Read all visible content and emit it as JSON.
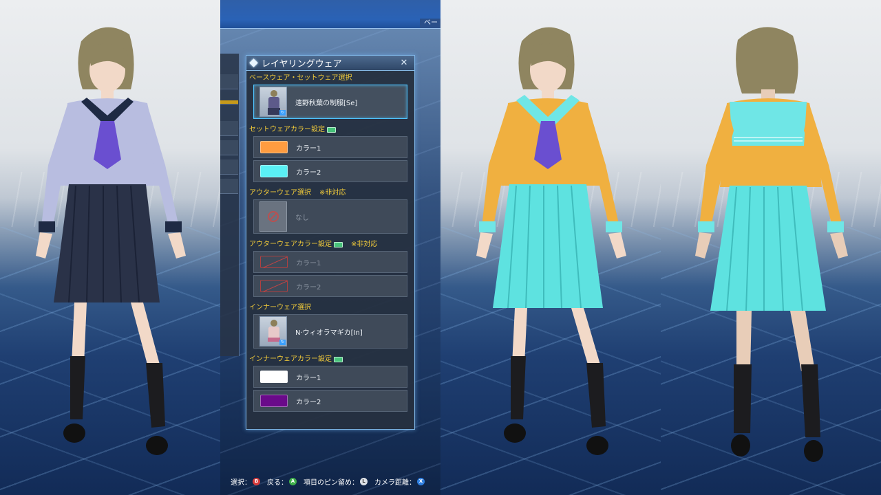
{
  "panel": {
    "title": "レイヤリングウェア",
    "close_icon": "close-icon",
    "sections": {
      "base": {
        "label": "ベースウェア・セットウェア選択",
        "item_name": "遠野秋葉の制服[Se]"
      },
      "set_color": {
        "label": "セットウェアカラー設定",
        "color1_label": "カラー1",
        "color1": "#ff9c40",
        "color2_label": "カラー2",
        "color2": "#5af0f5"
      },
      "outer": {
        "label": "アウターウェア選択",
        "note": "※非対応",
        "item_name": "なし"
      },
      "outer_color": {
        "label": "アウターウェアカラー設定",
        "note": "※非対応",
        "color1_label": "カラー1",
        "color2_label": "カラー2"
      },
      "inner": {
        "label": "インナーウェア選択",
        "item_name": "N·ウィオラマギカ[In]"
      },
      "inner_color": {
        "label": "インナーウェアカラー設定",
        "color1_label": "カラー1",
        "color1": "#ffffff",
        "color2_label": "カラー2",
        "color2": "#6a0a8a"
      }
    }
  },
  "top_bar": {
    "label": "ベー"
  },
  "guide": {
    "select": "選択：",
    "back": "戻る：",
    "pin": "項目のピン留め：",
    "camera": "カメラ距離：",
    "btn_b": "B",
    "btn_a": "A",
    "btn_ls": "L",
    "btn_x": "X"
  },
  "outfits": {
    "left": {
      "top": "#b8bde0",
      "collar": "#1e2a44",
      "tie": "#6a4fd0",
      "skirt": "#2a3248"
    },
    "mid": {
      "top": "#f0b040",
      "collar": "#6fe6e6",
      "tie": "#6a4fd0",
      "skirt": "#5ee2e0"
    },
    "right": {
      "top": "#f0b040",
      "collar": "#6fe6e6",
      "skirt": "#5ee2e0"
    },
    "hair": "#8f8560",
    "skin": "#f2d9c8",
    "socks": "#1c1c1f"
  }
}
